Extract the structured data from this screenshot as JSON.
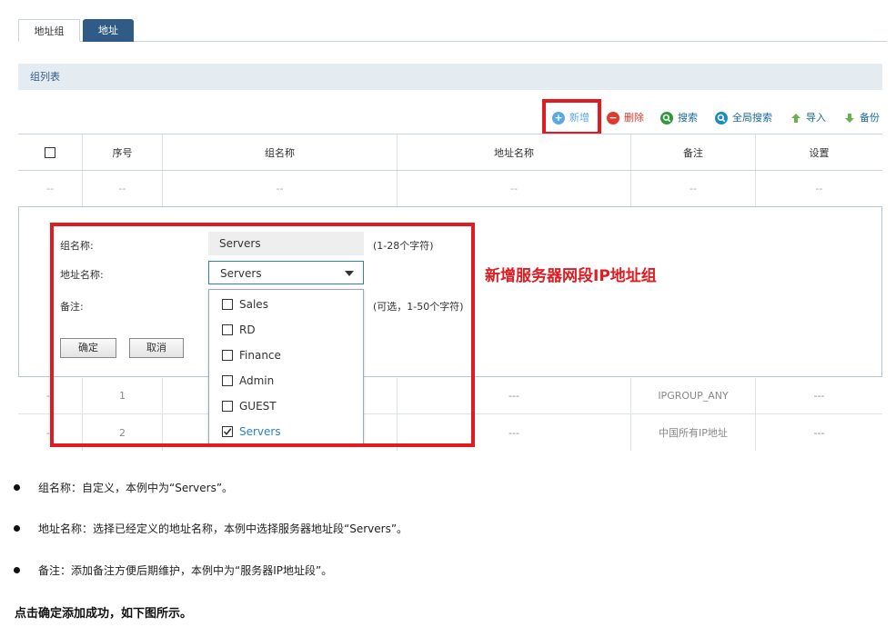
{
  "tabs": [
    {
      "label": "地址组"
    },
    {
      "label": "地址"
    }
  ],
  "section_title": "组列表",
  "toolbar": {
    "add": "新增",
    "delete": "删除",
    "search": "搜索",
    "global_search": "全局搜索",
    "import": "导入",
    "backup": "备份"
  },
  "table": {
    "headers": [
      "序号",
      "组名称",
      "地址名称",
      "备注",
      "设置"
    ],
    "empty_row": [
      "--",
      "--",
      "--",
      "--",
      "--",
      "--"
    ],
    "rows": [
      {
        "c0": "--",
        "seq": "1",
        "addr": "---",
        "note": "IPGROUP_ANY",
        "set": "---"
      },
      {
        "c0": "--",
        "seq": "2",
        "addr": "---",
        "note": "中国所有IP地址",
        "set": "---"
      }
    ]
  },
  "form": {
    "group_name_label": "组名称:",
    "group_name_value": "Servers",
    "group_name_hint": "(1-28个字符)",
    "address_label": "地址名称:",
    "address_value": "Servers",
    "remark_label": "备注:",
    "remark_hint": "(可选，1-50个字符)",
    "ok": "确定",
    "cancel": "取消",
    "options": [
      {
        "label": "Sales",
        "checked": false
      },
      {
        "label": "RD",
        "checked": false
      },
      {
        "label": "Finance",
        "checked": false
      },
      {
        "label": "Admin",
        "checked": false
      },
      {
        "label": "GUEST",
        "checked": false
      },
      {
        "label": "Servers",
        "checked": true
      }
    ]
  },
  "annotation": "新增服务器网段IP地址组",
  "bullets": [
    "组名称：自定义，本例中为“Servers”。",
    "地址名称：选择已经定义的地址名称，本例中选择服务器地址段“Servers”。",
    "备注：添加备注方便后期维护，本例中为“服务器IP地址段”。"
  ],
  "footer_note": "点击确定添加成功，如下图所示。",
  "colors": {
    "accent": "#2f5b86",
    "highlight": "#e01b22",
    "add_icon": "#5aa9e6",
    "delete_icon": "#e03a2e",
    "search_icon": "#2e9a3a",
    "global_search_icon": "#1a8cc0",
    "import_icon": "#6ab04c"
  }
}
